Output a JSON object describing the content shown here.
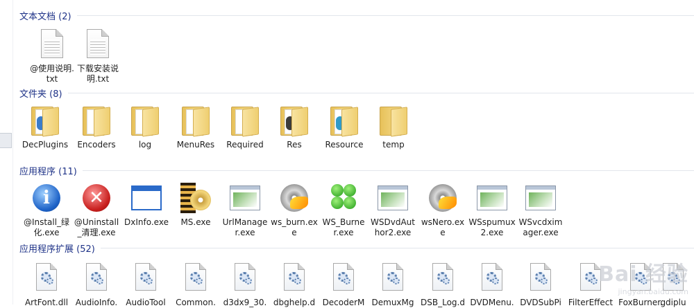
{
  "groups": [
    {
      "title": "文本文档 (2)",
      "items": [
        {
          "label": "@使用说明.txt",
          "icon": "text-file-icon"
        },
        {
          "label": "下载安装说明.txt",
          "icon": "text-file-icon"
        }
      ]
    },
    {
      "title": "文件夹 (8)",
      "items": [
        {
          "label": "DecPlugins",
          "icon": "folder-icon"
        },
        {
          "label": "Encoders",
          "icon": "folder-icon"
        },
        {
          "label": "log",
          "icon": "folder-icon"
        },
        {
          "label": "MenuRes",
          "icon": "folder-icon"
        },
        {
          "label": "Required",
          "icon": "folder-icon"
        },
        {
          "label": "Res",
          "icon": "folder-icon"
        },
        {
          "label": "Resource",
          "icon": "folder-icon"
        },
        {
          "label": "temp",
          "icon": "folder-icon"
        }
      ]
    },
    {
      "title": "应用程序 (11)",
      "items": [
        {
          "label": "@Install_绿化.exe",
          "icon": "info-icon"
        },
        {
          "label": "@Uninstall_清理.exe",
          "icon": "error-icon"
        },
        {
          "label": "DxInfo.exe",
          "icon": "window-icon"
        },
        {
          "label": "MS.exe",
          "icon": "film-disc-icon"
        },
        {
          "label": "UrlManager.exe",
          "icon": "app-window-icon"
        },
        {
          "label": "ws_burn.exe",
          "icon": "burn-disc-icon"
        },
        {
          "label": "WS_Burner.exe",
          "icon": "clover-icon"
        },
        {
          "label": "WSDvdAuthor2.exe",
          "icon": "app-window-icon"
        },
        {
          "label": "wsNero.exe",
          "icon": "burn-disc-icon"
        },
        {
          "label": "WSspumux2.exe",
          "icon": "app-window-icon"
        },
        {
          "label": "WSvcdximager.exe",
          "icon": "app-window-icon"
        }
      ]
    },
    {
      "title": "应用程序扩展 (52)",
      "items": [
        {
          "label": "ArtFont.dll",
          "icon": "dll-icon"
        },
        {
          "label": "AudioInfo.",
          "icon": "dll-icon"
        },
        {
          "label": "AudioTool",
          "icon": "dll-icon"
        },
        {
          "label": "Common.",
          "icon": "dll-icon"
        },
        {
          "label": "d3dx9_30.",
          "icon": "dll-icon"
        },
        {
          "label": "dbghelp.d",
          "icon": "dll-icon"
        },
        {
          "label": "DecoderM",
          "icon": "dll-icon"
        },
        {
          "label": "DemuxMg",
          "icon": "dll-icon"
        },
        {
          "label": "DSB_Log.d",
          "icon": "dll-icon"
        },
        {
          "label": "DVDMenu.",
          "icon": "dll-icon"
        },
        {
          "label": "DVDSubPi",
          "icon": "dll-icon"
        },
        {
          "label": "FilterEffect",
          "icon": "dll-icon"
        },
        {
          "label": "FoxBurner.",
          "icon": "dll-icon"
        },
        {
          "label": "gdiplu",
          "icon": "dll-icon"
        }
      ]
    }
  ],
  "watermark": {
    "big": "Bai 经验",
    "small": "jingyan.baidu.com"
  }
}
